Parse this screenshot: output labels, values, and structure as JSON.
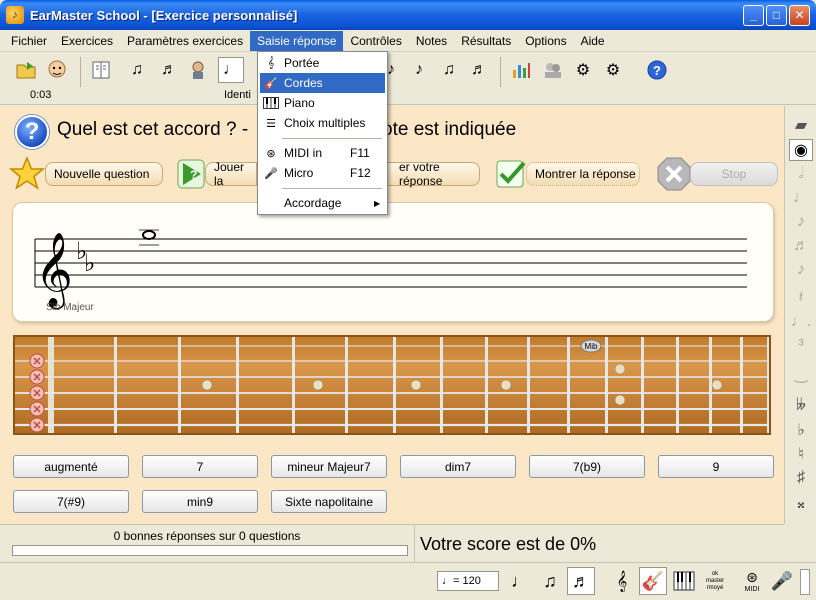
{
  "window": {
    "title": "EarMaster School - [Exercice personnalisé]"
  },
  "menubar": {
    "items": [
      "Fichier",
      "Exercices",
      "Paramètres exercices",
      "Saisie réponse",
      "Contrôles",
      "Notes",
      "Résultats",
      "Options",
      "Aide"
    ]
  },
  "toolbar": {
    "timer": "0:03",
    "identity_label": "Identi"
  },
  "question": {
    "text": "Quel est cet accord ? -",
    "tail": "ote est indiquée"
  },
  "actions": {
    "new_question": "Nouvelle question",
    "play": "Jouer la",
    "answer": "er votre réponse",
    "show_answer": "Montrer la réponse",
    "stop": "Stop"
  },
  "staff": {
    "key_caption": "Sib Majeur"
  },
  "fretboard": {
    "marker_label": "Mib"
  },
  "answers": [
    "augmenté",
    "7",
    "mineur Majeur7",
    "dim7",
    "7(b9)",
    "9",
    "7(#9)",
    "min9",
    "Sixte napolitaine"
  ],
  "status": {
    "summary": "0 bonnes réponses sur 0 questions",
    "score": "Votre score est de 0%",
    "progress": 0
  },
  "bottombar": {
    "tempo": "= 120",
    "midi_label": "MIDI",
    "ok_label": "ok",
    "master_label": "master",
    "rmoyé_label": "rmoyé"
  },
  "dropdown": {
    "items": [
      {
        "label": "Portée",
        "icon": "staff-icon"
      },
      {
        "label": "Cordes",
        "icon": "guitar-icon"
      },
      {
        "label": "Piano",
        "icon": "piano-icon"
      },
      {
        "label": "Choix multiples",
        "icon": "list-icon"
      },
      {
        "label": "MIDI in",
        "shortcut": "F11",
        "icon": "midi-icon"
      },
      {
        "label": "Micro",
        "shortcut": "F12",
        "icon": "microphone-icon"
      },
      {
        "label": "Accordage",
        "icon": "submenu-arrow-icon"
      }
    ],
    "highlighted": "Cordes"
  },
  "colors": {
    "accent": "#316ac5",
    "panel": "#fbe6c5",
    "titlebar": "#0d53d6"
  }
}
